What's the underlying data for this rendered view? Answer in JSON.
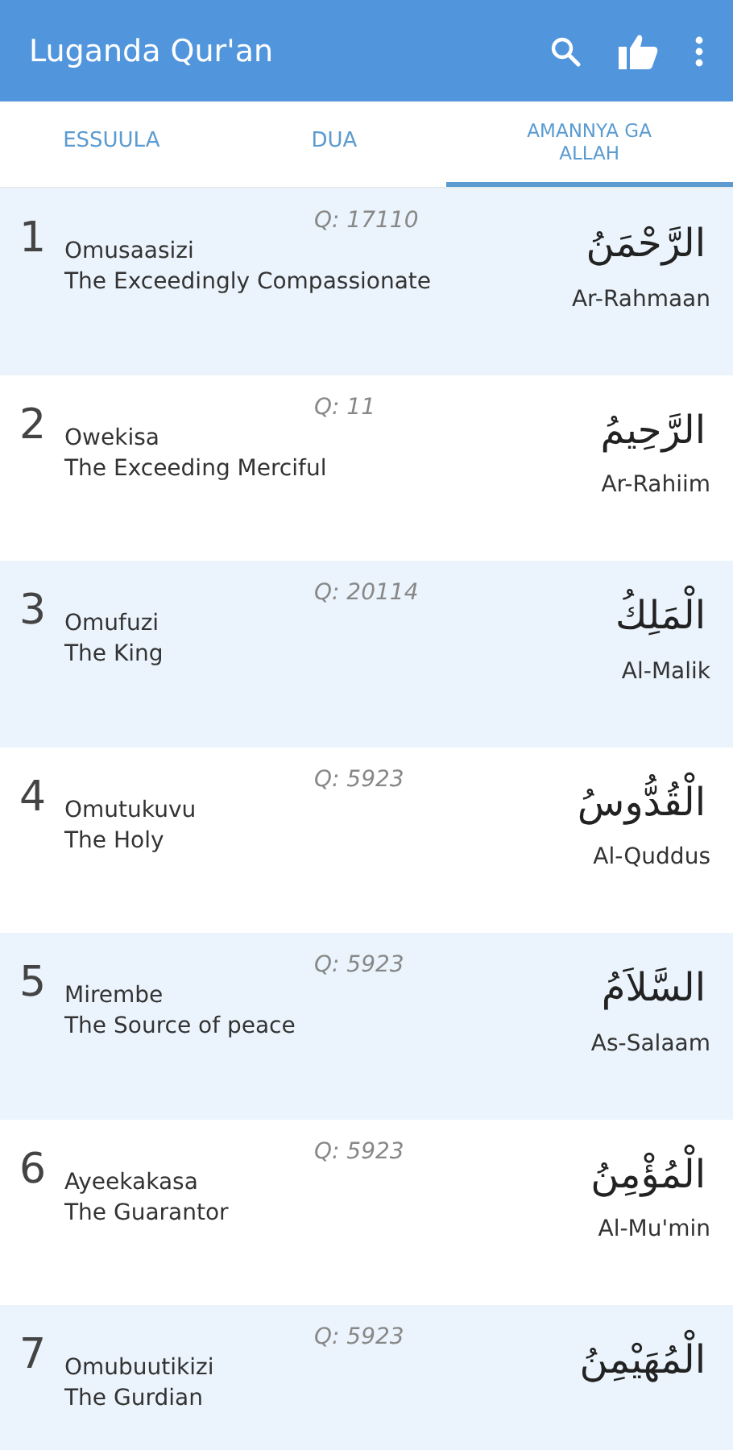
{
  "app_bar": {
    "title": "Luganda Qur'an"
  },
  "tabs": [
    {
      "label": "ESSUULA",
      "selected": false
    },
    {
      "label": "DUA",
      "selected": false
    },
    {
      "label": "AMANNYA GA ALLAH",
      "selected": true
    }
  ],
  "names": [
    {
      "number": "1",
      "reference": "Q: 17110",
      "luganda": "Omusaasizi",
      "english": "The Exceedingly Compassionate",
      "arabic": "الرَّحْمَنُ",
      "transliteration": "Ar-Rahmaan"
    },
    {
      "number": "2",
      "reference": "Q: 11",
      "luganda": "Owekisa",
      "english": "The Exceeding Merciful",
      "arabic": "الرَّحِيمُ",
      "transliteration": "Ar-Rahiim"
    },
    {
      "number": "3",
      "reference": "Q: 20114",
      "luganda": "Omufuzi",
      "english": "The King",
      "arabic": "الْمَلِكُ",
      "transliteration": "Al-Malik"
    },
    {
      "number": "4",
      "reference": "Q: 5923",
      "luganda": "Omutukuvu",
      "english": "The Holy",
      "arabic": "الْقُدُّوسُ",
      "transliteration": "Al-Quddus"
    },
    {
      "number": "5",
      "reference": "Q: 5923",
      "luganda": "Mirembe",
      "english": "The Source of peace",
      "arabic": "السَّلاَمُ",
      "transliteration": "As-Salaam"
    },
    {
      "number": "6",
      "reference": "Q: 5923",
      "luganda": "Ayeekakasa",
      "english": "The Guarantor",
      "arabic": "الْمُؤْمِنُ",
      "transliteration": "Al-Mu'min"
    },
    {
      "number": "7",
      "reference": "Q: 5923",
      "luganda": "Omubuutikizi",
      "english": "The Gurdian",
      "arabic": "الْمُهَيْمِنُ"
    }
  ]
}
